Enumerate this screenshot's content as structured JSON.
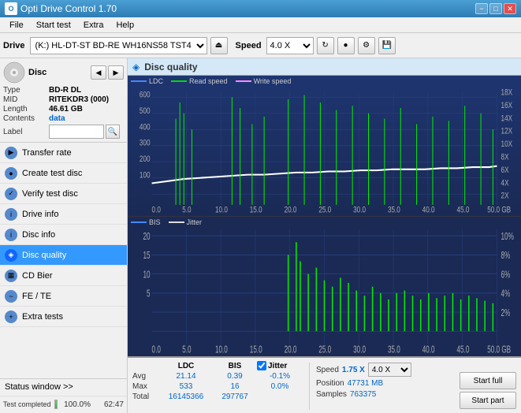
{
  "app": {
    "title": "Opti Drive Control 1.70",
    "icon_label": "O"
  },
  "titlebar": {
    "minimize_label": "−",
    "maximize_label": "□",
    "close_label": "✕"
  },
  "menubar": {
    "items": [
      "File",
      "Start test",
      "Extra",
      "Help"
    ]
  },
  "toolbar": {
    "drive_label": "Drive",
    "drive_name": "(K:)  HL-DT-ST BD-RE  WH16NS58 TST4",
    "speed_label": "Speed",
    "speed_value": "4.0 X"
  },
  "disc": {
    "title": "Disc",
    "type_label": "Type",
    "type_value": "BD-R DL",
    "mid_label": "MID",
    "mid_value": "RITEKDR3 (000)",
    "length_label": "Length",
    "length_value": "46.61 GB",
    "contents_label": "Contents",
    "contents_value": "data",
    "label_label": "Label",
    "label_value": ""
  },
  "nav": {
    "items": [
      {
        "id": "transfer-rate",
        "label": "Transfer rate",
        "color": "#5599dd"
      },
      {
        "id": "create-test-disc",
        "label": "Create test disc",
        "color": "#5599dd"
      },
      {
        "id": "verify-test-disc",
        "label": "Verify test disc",
        "color": "#5599dd"
      },
      {
        "id": "drive-info",
        "label": "Drive info",
        "color": "#5599dd"
      },
      {
        "id": "disc-info",
        "label": "Disc info",
        "color": "#5599dd"
      },
      {
        "id": "disc-quality",
        "label": "Disc quality",
        "color": "#3399ff",
        "active": true
      },
      {
        "id": "cd-bier",
        "label": "CD Bier",
        "color": "#5599dd"
      },
      {
        "id": "fe-te",
        "label": "FE / TE",
        "color": "#5599dd"
      },
      {
        "id": "extra-tests",
        "label": "Extra tests",
        "color": "#5599dd"
      }
    ]
  },
  "status": {
    "window_label": "Status window >>",
    "progress_pct": "100.0%",
    "progress_value": 100,
    "time_label": "62:47",
    "completed_label": "Test completed"
  },
  "chart": {
    "title": "Disc quality",
    "legend": [
      {
        "label": "LDC",
        "color": "#4488ff"
      },
      {
        "label": "Read speed",
        "color": "#00dd00"
      },
      {
        "label": "Write speed",
        "color": "#ff88ff"
      }
    ],
    "legend2": [
      {
        "label": "BIS",
        "color": "#4488ff"
      },
      {
        "label": "Jitter",
        "color": "#dddddd"
      }
    ],
    "x_max": "50.0",
    "y1_max": "600",
    "y1_right_labels": [
      "18X",
      "16X",
      "14X",
      "12X",
      "10X",
      "8X",
      "6X",
      "4X",
      "2X"
    ],
    "y2_right_labels": [
      "10%",
      "8%",
      "6%",
      "4%",
      "2%"
    ],
    "x_labels": [
      "0.0",
      "5.0",
      "10.0",
      "15.0",
      "20.0",
      "25.0",
      "30.0",
      "35.0",
      "40.0",
      "45.0",
      "50.0 GB"
    ]
  },
  "stats": {
    "ldc_label": "LDC",
    "bis_label": "BIS",
    "jitter_label": "Jitter",
    "jitter_checked": true,
    "speed_label": "Speed",
    "speed_value": "1.75 X",
    "speed_select": "4.0 X",
    "avg_label": "Avg",
    "avg_ldc": "21.14",
    "avg_bis": "0.39",
    "avg_jitter": "-0.1%",
    "max_label": "Max",
    "max_ldc": "533",
    "max_bis": "16",
    "max_jitter": "0.0%",
    "total_label": "Total",
    "total_ldc": "16145366",
    "total_bis": "297767",
    "position_label": "Position",
    "position_value": "47731 MB",
    "samples_label": "Samples",
    "samples_value": "763375",
    "start_full_label": "Start full",
    "start_part_label": "Start part"
  }
}
